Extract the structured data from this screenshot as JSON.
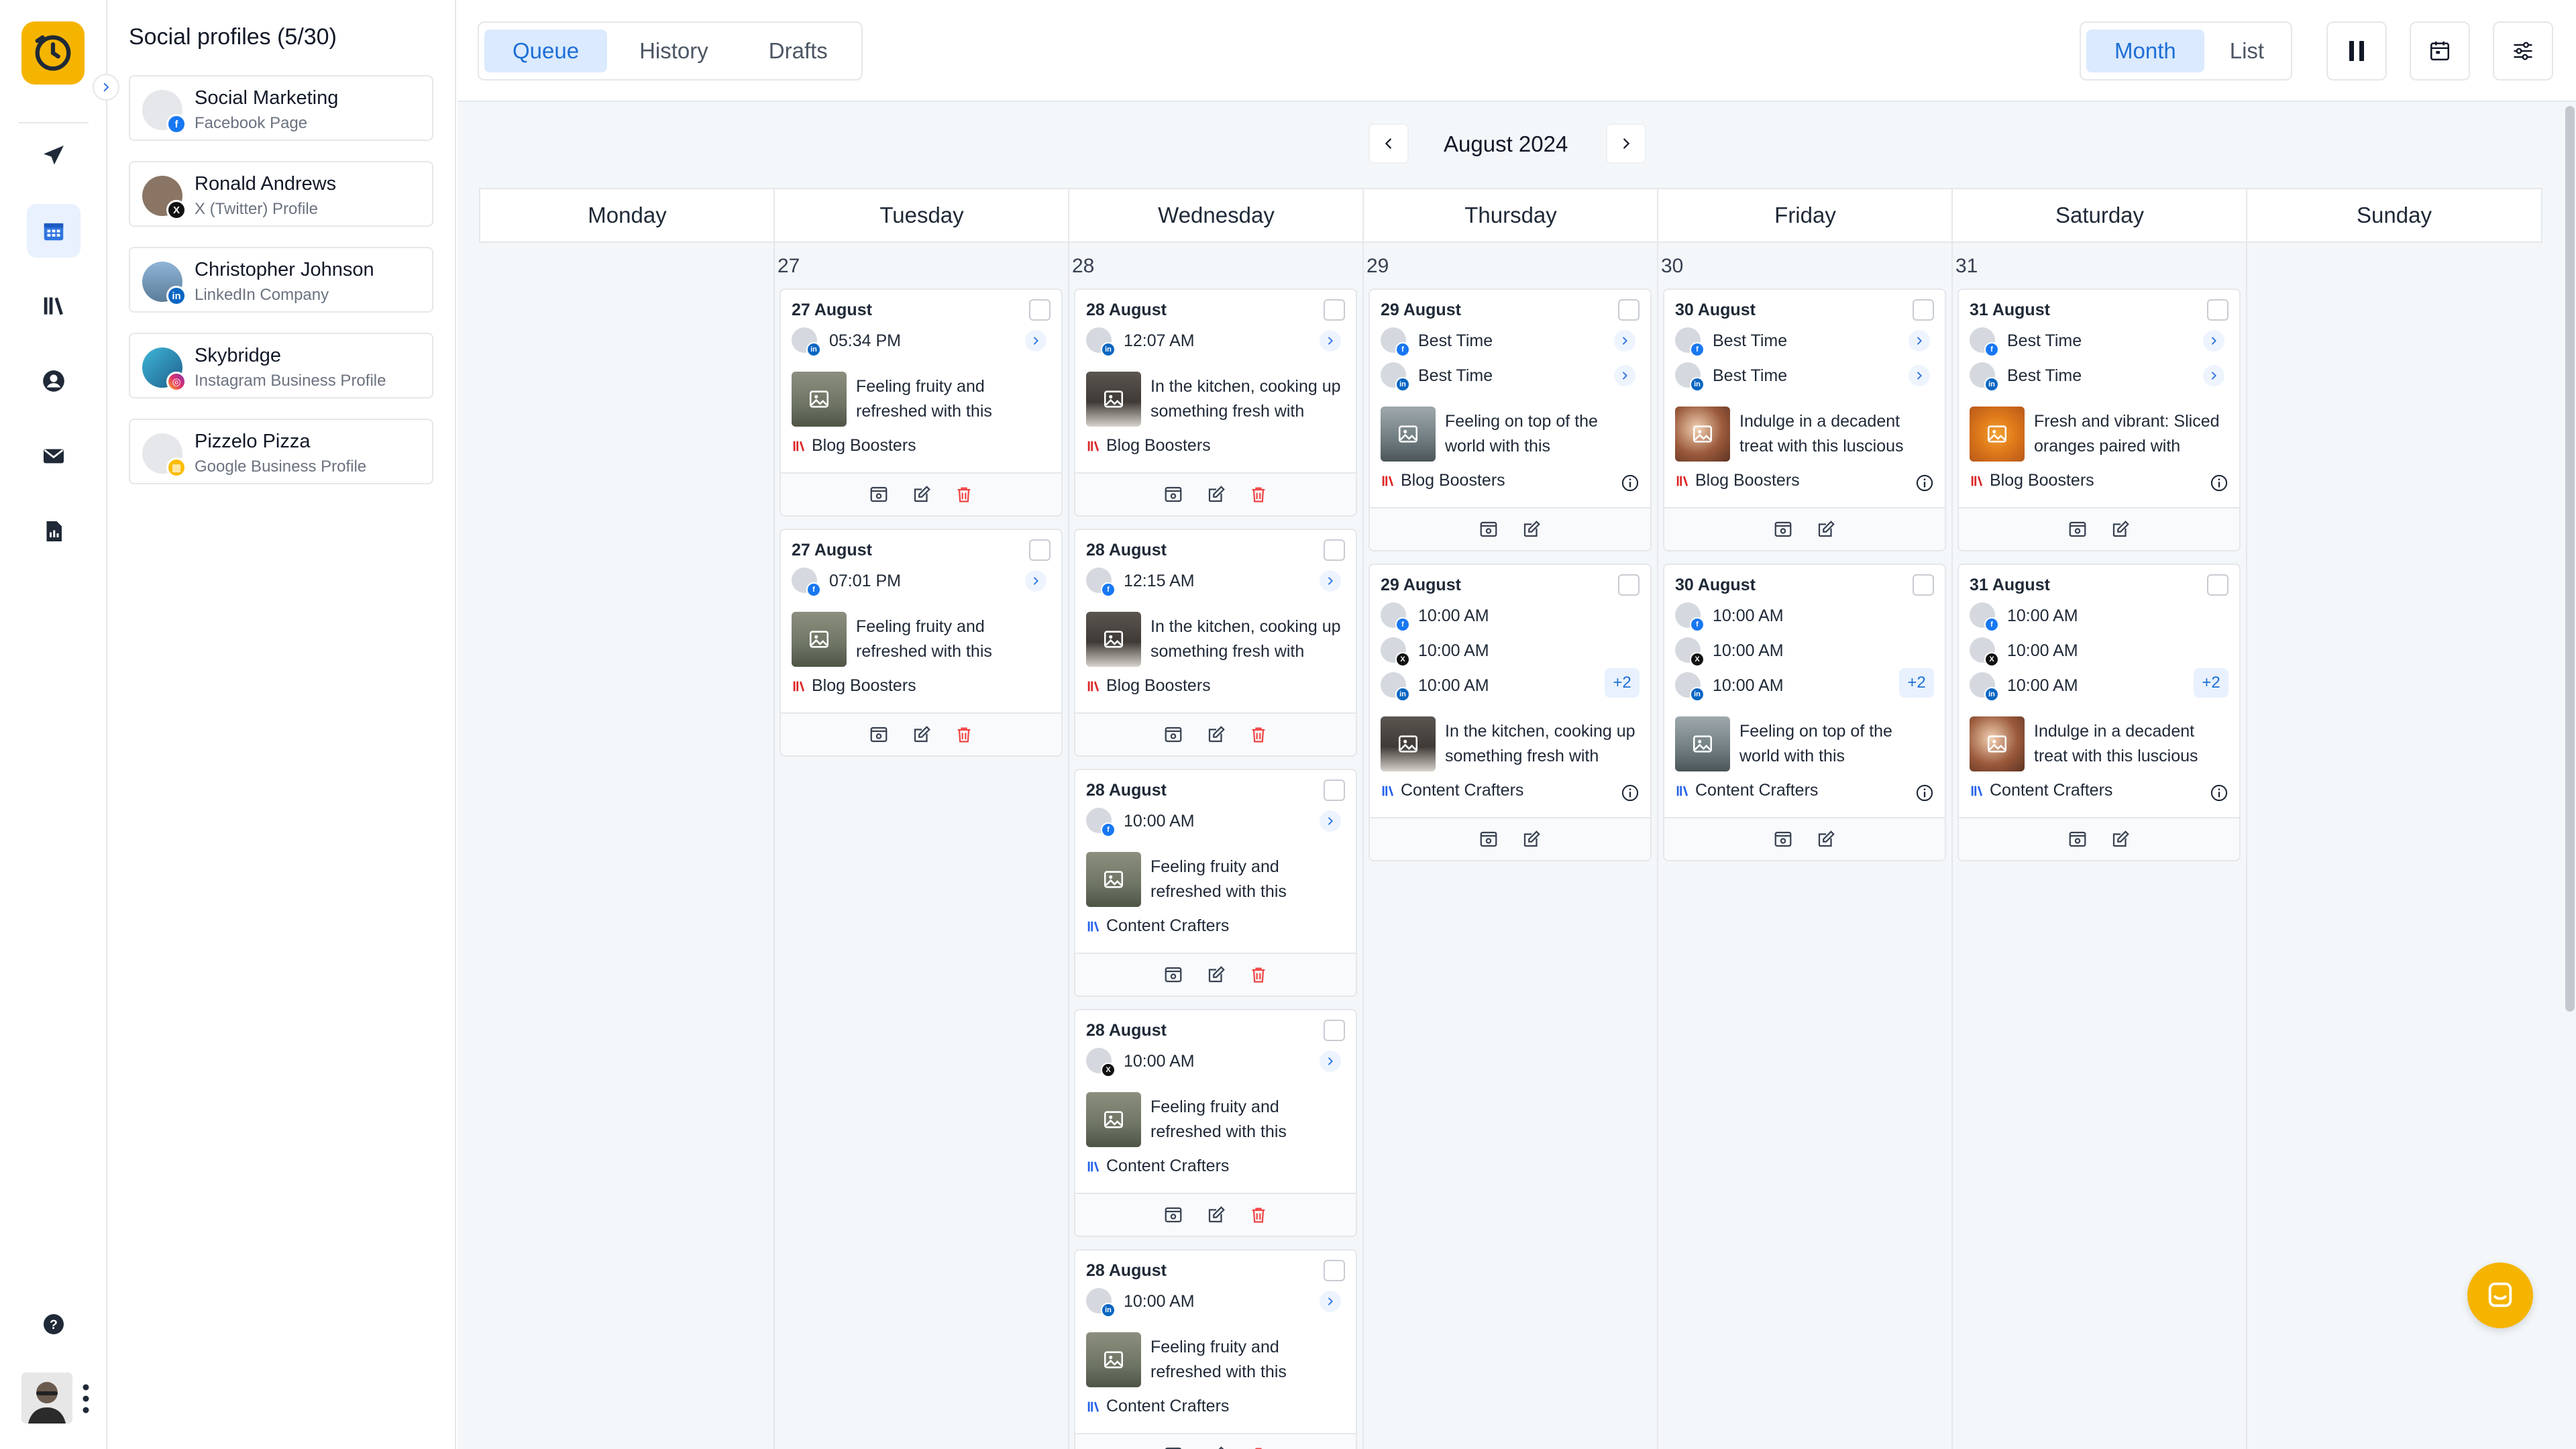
{
  "colors": {
    "brand": "#f5b400",
    "accent": "#1d6fd6",
    "facebook": "#1877f2",
    "linkedin": "#0a66c2",
    "x": "#111111",
    "instagram": "#e1306c",
    "google_business": "#fbbc04",
    "blog_boosters": "#dc2626",
    "content_crafters": "#2563eb",
    "delete": "#ef4444"
  },
  "rail": {
    "items": [
      {
        "name": "send-icon"
      },
      {
        "name": "calendar-icon",
        "active": true
      },
      {
        "name": "library-icon"
      },
      {
        "name": "user-circle-icon"
      },
      {
        "name": "mail-icon"
      },
      {
        "name": "report-icon"
      }
    ],
    "help_icon": "help-icon",
    "more_icon": "more-vertical-icon"
  },
  "profiles": {
    "title": "Social profiles (5/30)",
    "items": [
      {
        "name": "Social Marketing",
        "type": "Facebook Page",
        "network": "facebook"
      },
      {
        "name": "Ronald Andrews",
        "type": "X (Twitter) Profile",
        "network": "x"
      },
      {
        "name": "Christopher Johnson",
        "type": "LinkedIn Company",
        "network": "linkedin"
      },
      {
        "name": "Skybridge",
        "type": "Instagram Business Profile",
        "network": "instagram"
      },
      {
        "name": "Pizzelo Pizza",
        "type": "Google Business Profile",
        "network": "google"
      }
    ]
  },
  "toolbar": {
    "tabs": [
      "Queue",
      "History",
      "Drafts"
    ],
    "active_tab": "Queue",
    "views": [
      "Month",
      "List"
    ],
    "active_view": "Month",
    "buttons": [
      "pause-icon",
      "calendar-view-icon",
      "filter-settings-icon"
    ]
  },
  "calendar": {
    "month_label": "August 2024",
    "weekdays": [
      "Monday",
      "Tuesday",
      "Wednesday",
      "Thursday",
      "Friday",
      "Saturday",
      "Sunday"
    ],
    "day_numbers": [
      "",
      "27",
      "28",
      "29",
      "30",
      "31",
      ""
    ]
  },
  "cards": [
    {
      "col": 1,
      "date": "27 August",
      "rows": [
        {
          "time": "05:34 PM",
          "net": "linkedin"
        }
      ],
      "text": "Feeling fruity and refreshed with this",
      "board": "Blog Boosters",
      "board_color": "red",
      "thumb": "room"
    },
    {
      "col": 1,
      "date": "27 August",
      "rows": [
        {
          "time": "07:01 PM",
          "net": "facebook"
        }
      ],
      "text": "Feeling fruity and refreshed with this",
      "board": "Blog Boosters",
      "board_color": "red",
      "thumb": "room"
    },
    {
      "col": 2,
      "date": "28 August",
      "rows": [
        {
          "time": "12:07 AM",
          "net": "linkedin"
        }
      ],
      "text": "In the kitchen, cooking up something fresh with",
      "board": "Blog Boosters",
      "board_color": "red",
      "thumb": "kitchen"
    },
    {
      "col": 2,
      "date": "28 August",
      "rows": [
        {
          "time": "12:15 AM",
          "net": "facebook"
        }
      ],
      "text": "In the kitchen, cooking up something fresh with",
      "board": "Blog Boosters",
      "board_color": "red",
      "thumb": "kitchen"
    },
    {
      "col": 2,
      "date": "28 August",
      "rows": [
        {
          "time": "10:00 AM",
          "net": "facebook"
        }
      ],
      "text": "Feeling fruity and refreshed with this",
      "board": "Content Crafters",
      "board_color": "blue",
      "thumb": "room"
    },
    {
      "col": 2,
      "date": "28 August",
      "rows": [
        {
          "time": "10:00 AM",
          "net": "x"
        }
      ],
      "text": "Feeling fruity and refreshed with this",
      "board": "Content Crafters",
      "board_color": "blue",
      "thumb": "room"
    },
    {
      "col": 2,
      "date": "28 August",
      "rows": [
        {
          "time": "10:00 AM",
          "net": "linkedin"
        }
      ],
      "text": "Feeling fruity and refreshed with this",
      "board": "Content Crafters",
      "board_color": "blue",
      "thumb": "room"
    },
    {
      "col": 3,
      "date": "29 August",
      "rows": [
        {
          "time": "Best Time",
          "net": "facebook"
        },
        {
          "time": "Best Time",
          "net": "linkedin"
        }
      ],
      "text": "Feeling on top of the world with this",
      "board": "Blog Boosters",
      "board_color": "red",
      "thumb": "mountain"
    },
    {
      "col": 3,
      "date": "29 August",
      "rows": [
        {
          "time": "10:00 AM",
          "net": "facebook"
        },
        {
          "time": "10:00 AM",
          "net": "x"
        },
        {
          "time": "10:00 AM",
          "net": "linkedin"
        }
      ],
      "more": "+2",
      "text": "In the kitchen, cooking up something fresh with",
      "board": "Content Crafters",
      "board_color": "blue",
      "thumb": "kitchen"
    },
    {
      "col": 4,
      "date": "30 August",
      "rows": [
        {
          "time": "Best Time",
          "net": "facebook"
        },
        {
          "time": "Best Time",
          "net": "linkedin"
        }
      ],
      "text": "Indulge in a decadent treat with this luscious",
      "board": "Blog Boosters",
      "board_color": "red",
      "thumb": "dessert"
    },
    {
      "col": 4,
      "date": "30 August",
      "rows": [
        {
          "time": "10:00 AM",
          "net": "facebook"
        },
        {
          "time": "10:00 AM",
          "net": "x"
        },
        {
          "time": "10:00 AM",
          "net": "linkedin"
        }
      ],
      "more": "+2",
      "text": "Feeling on top of the world with this",
      "board": "Content Crafters",
      "board_color": "blue",
      "thumb": "mountain"
    },
    {
      "col": 5,
      "date": "31 August",
      "rows": [
        {
          "time": "Best Time",
          "net": "facebook"
        },
        {
          "time": "Best Time",
          "net": "linkedin"
        }
      ],
      "text": "Fresh and vibrant: Sliced oranges paired with",
      "board": "Blog Boosters",
      "board_color": "red",
      "thumb": "orange"
    },
    {
      "col": 5,
      "date": "31 August",
      "rows": [
        {
          "time": "10:00 AM",
          "net": "facebook"
        },
        {
          "time": "10:00 AM",
          "net": "x"
        },
        {
          "time": "10:00 AM",
          "net": "linkedin"
        }
      ],
      "more": "+2",
      "text": "Indulge in a decadent treat with this luscious",
      "board": "Content Crafters",
      "board_color": "blue",
      "thumb": "dessert"
    }
  ]
}
